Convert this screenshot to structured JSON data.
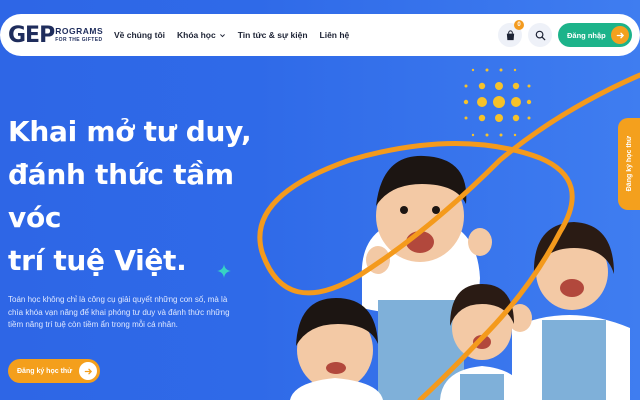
{
  "logo": {
    "mark": "GEP",
    "line1": "ROGRAMS",
    "line2": "FOR THE GIFTED"
  },
  "nav": {
    "items": [
      {
        "label": "Về chúng tôi"
      },
      {
        "label": "Khóa học",
        "has_dropdown": true
      },
      {
        "label": "Tin tức & sự kiện"
      },
      {
        "label": "Liên hệ"
      }
    ]
  },
  "header": {
    "cart_count": "0",
    "login_label": "Đăng nhập"
  },
  "hero": {
    "headline_lines": [
      "Khai mở tư duy,",
      "đánh thức tầm",
      "vóc",
      "trí tuệ Việt."
    ],
    "description": "Toán học không chỉ là công cụ giải quyết những con số, mà là chìa khóa vạn năng để khai phóng tư duy và đánh thức những tiềm năng trí tuệ còn tiềm ẩn trong mỗi cá nhân.",
    "cta_label": "Đăng ký học thử"
  },
  "side_tab": {
    "label": "Đăng ký học thử"
  },
  "colors": {
    "background": "#2f6ae8",
    "accent_orange": "#f4a01d",
    "login_green": "#1cb38a",
    "dots_yellow": "#f6c22a",
    "text_dark": "#1d2335"
  },
  "icons": {
    "cart": "shopping-bag-icon",
    "search": "search-icon",
    "arrow": "arrow-right-icon",
    "dropdown": "chevron-down-icon",
    "sparkle": "sparkle-icon"
  }
}
